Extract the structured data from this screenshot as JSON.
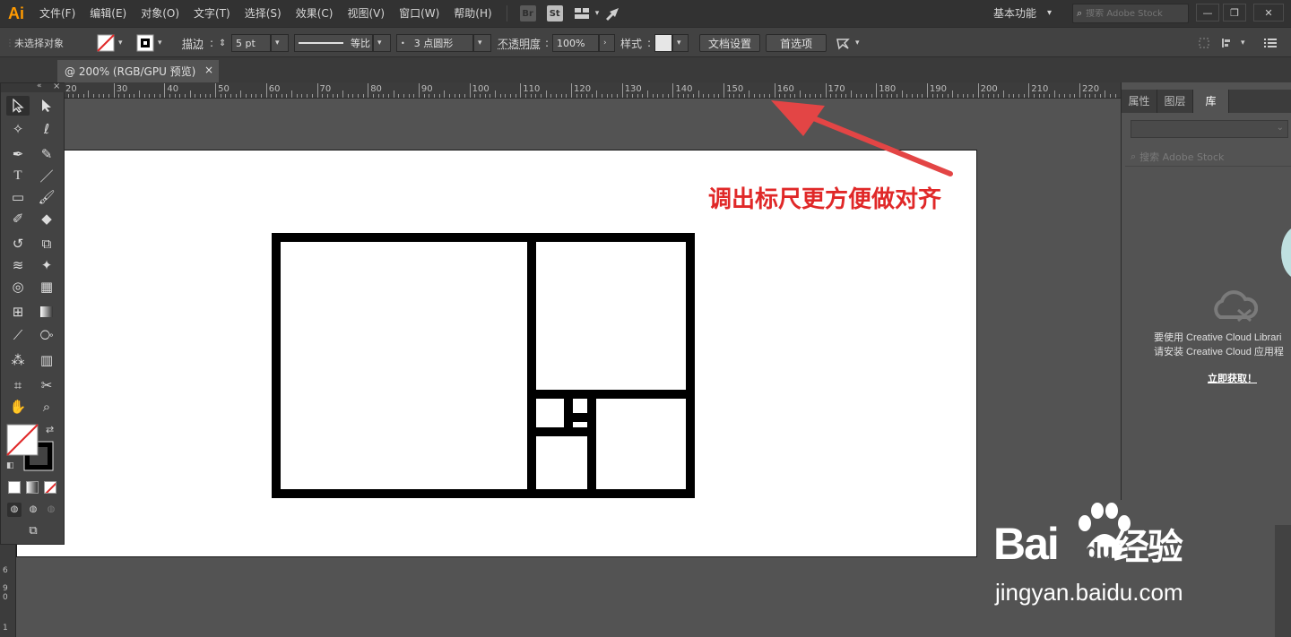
{
  "app": {
    "logo": "Ai"
  },
  "menu": {
    "items": [
      "文件(F)",
      "编辑(E)",
      "对象(O)",
      "文字(T)",
      "选择(S)",
      "效果(C)",
      "视图(V)",
      "窗口(W)",
      "帮助(H)"
    ],
    "bridge_label": "Br",
    "stock_label": "St",
    "workspace": "基本功能",
    "stock_search_placeholder": "搜索 Adobe Stock",
    "window_buttons": [
      "—",
      "❐",
      "✕"
    ]
  },
  "control_bar": {
    "selection_status": "未选择对象",
    "stroke_label": "描边",
    "stroke_weight": "5 pt",
    "stroke_profile": "等比",
    "brush": "3 点圆形",
    "opacity_label": "不透明度",
    "opacity_value": "100%",
    "style_label": "样式",
    "doc_setup_button": "文档设置",
    "preferences_button": "首选项"
  },
  "document_tab": {
    "title": "@ 200% (RGB/GPU 预览)",
    "close": "×"
  },
  "ruler": {
    "labels": [
      "20",
      "30",
      "40",
      "50",
      "60",
      "70",
      "80",
      "90",
      "100",
      "110",
      "120",
      "130",
      "140",
      "150",
      "160",
      "170",
      "180",
      "190",
      "200",
      "210",
      "220"
    ],
    "vertical_labels": [
      "6",
      "9",
      "0",
      "1"
    ]
  },
  "annotation": {
    "text": "调出标尺更方便做对齐",
    "color": "#e02828"
  },
  "right_panel": {
    "tabs": [
      "属性",
      "图层",
      "库"
    ],
    "active_tab": "库",
    "search_placeholder": "搜索 Adobe Stock",
    "message_line1": "要使用 Creative Cloud Librari",
    "message_line2": "请安装 Creative Cloud 应用程",
    "link": "立即获取！"
  },
  "watermark": {
    "brand": "Bai",
    "brand_suffix": "du",
    "brand_cn": "经验",
    "url": "jingyan.baidu.com"
  },
  "colors": {
    "accent_logo": "#ff9a00",
    "annotation": "#e02828"
  }
}
